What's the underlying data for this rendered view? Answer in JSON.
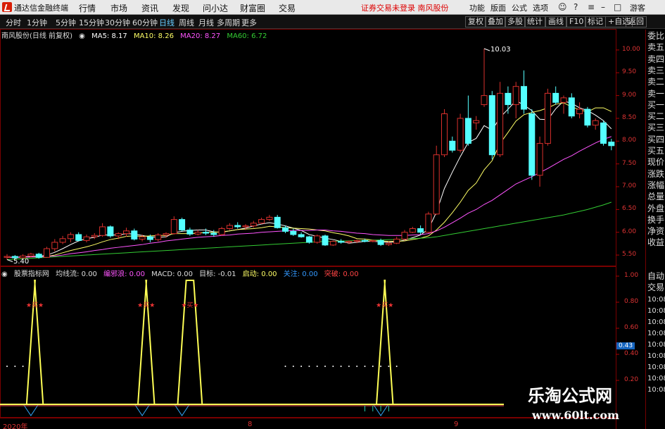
{
  "menubar": {
    "app_title": "通达信金融终端",
    "menus": [
      "行情",
      "市场",
      "资讯",
      "发现",
      "问小达",
      "财富圈",
      "交易"
    ],
    "alert": "证券交易未登录  南风股份",
    "right_items": [
      "功能",
      "版面",
      "公式",
      "选项"
    ],
    "guest": "游客"
  },
  "toolbar": {
    "periods": [
      "分时",
      "1分钟",
      "5分钟",
      "15分钟",
      "30分钟",
      "60分钟",
      "日线",
      "周线",
      "月线",
      "多周期",
      "更多"
    ],
    "active_period": "日线",
    "buttons": [
      "复权",
      "叠加",
      "多股",
      "统计",
      "画线",
      "F10",
      "标记",
      "+自选",
      "返回"
    ]
  },
  "price_info": {
    "stock": "南风股份(日线 前复权)",
    "ma5": "MA5: 8.17",
    "ma10": "MA10: 8.26",
    "ma20": "MA20: 8.27",
    "ma60": "MA60: 6.72"
  },
  "indicator_info": {
    "name": "股票指标网",
    "lamp": "均线流: 0.00",
    "monopoly": "编邪浪: 0.00",
    "macd": "MACD: 0.00",
    "target": "目标: -0.01",
    "start": "启动: 0.00",
    "focus": "关注: 0.00",
    "break": "突破: 0.00"
  },
  "annotations": {
    "high": "10.03",
    "low": "5.40",
    "buy_label": "★买★"
  },
  "price_axis": [
    "10.00",
    "9.50",
    "9.00",
    "8.50",
    "8.00",
    "7.50",
    "7.00",
    "6.50",
    "6.00",
    "5.50"
  ],
  "indicator_axis": [
    "1.00",
    "0.80",
    "0.60",
    "0.40",
    "0.20"
  ],
  "indicator_current": "0.43",
  "date_axis": [
    "2020年",
    "8",
    "9"
  ],
  "right_panel": {
    "items": [
      "委比",
      "卖五",
      "卖四",
      "卖三",
      "卖二",
      "卖一",
      "买一",
      "买二",
      "买三",
      "买四",
      "买五",
      "现价",
      "涨跌",
      "涨幅",
      "总量",
      "外盘",
      "换手",
      "净资",
      "收益"
    ],
    "lower": [
      "自动",
      "交易"
    ],
    "times": [
      "10:08",
      "10:08",
      "10:08",
      "10:08",
      "10:08",
      "10:08",
      "10:08",
      "10:08",
      "10:08"
    ]
  },
  "watermark": {
    "line1": "乐淘公式网",
    "line2": "www.60lt.com"
  },
  "colors": {
    "up": "#d9302c",
    "down": "#54ffff",
    "ma5": "#ffffff",
    "ma10": "#ffff66",
    "ma20": "#ff55ff",
    "ma60": "#33cc33",
    "indicator_line": "#ffff55"
  },
  "chart_data": {
    "type": "candlestick",
    "y_range": [
      5.3,
      10.2
    ],
    "candles": [
      {
        "o": 5.45,
        "h": 5.52,
        "l": 5.4,
        "c": 5.47
      },
      {
        "o": 5.47,
        "h": 5.5,
        "l": 5.42,
        "c": 5.44
      },
      {
        "o": 5.44,
        "h": 5.52,
        "l": 5.42,
        "c": 5.48
      },
      {
        "o": 5.48,
        "h": 5.55,
        "l": 5.45,
        "c": 5.52
      },
      {
        "o": 5.52,
        "h": 5.55,
        "l": 5.42,
        "c": 5.45
      },
      {
        "o": 5.45,
        "h": 5.68,
        "l": 5.44,
        "c": 5.64
      },
      {
        "o": 5.64,
        "h": 5.85,
        "l": 5.58,
        "c": 5.78
      },
      {
        "o": 5.78,
        "h": 5.92,
        "l": 5.74,
        "c": 5.86
      },
      {
        "o": 5.86,
        "h": 6.0,
        "l": 5.78,
        "c": 5.95
      },
      {
        "o": 5.95,
        "h": 6.0,
        "l": 5.8,
        "c": 5.82
      },
      {
        "o": 5.82,
        "h": 5.95,
        "l": 5.78,
        "c": 5.9
      },
      {
        "o": 5.9,
        "h": 5.98,
        "l": 5.85,
        "c": 5.93
      },
      {
        "o": 5.93,
        "h": 6.2,
        "l": 5.9,
        "c": 6.12
      },
      {
        "o": 6.12,
        "h": 6.15,
        "l": 5.88,
        "c": 5.92
      },
      {
        "o": 5.92,
        "h": 6.0,
        "l": 5.85,
        "c": 5.97
      },
      {
        "o": 5.97,
        "h": 6.1,
        "l": 5.9,
        "c": 6.03
      },
      {
        "o": 6.03,
        "h": 6.08,
        "l": 5.82,
        "c": 5.85
      },
      {
        "o": 5.85,
        "h": 5.95,
        "l": 5.8,
        "c": 5.9
      },
      {
        "o": 5.9,
        "h": 5.95,
        "l": 5.78,
        "c": 5.84
      },
      {
        "o": 5.84,
        "h": 5.98,
        "l": 5.8,
        "c": 5.94
      },
      {
        "o": 5.94,
        "h": 6.0,
        "l": 5.88,
        "c": 5.97
      },
      {
        "o": 5.97,
        "h": 6.35,
        "l": 5.95,
        "c": 6.28
      },
      {
        "o": 6.28,
        "h": 6.32,
        "l": 6.02,
        "c": 6.05
      },
      {
        "o": 6.05,
        "h": 6.1,
        "l": 5.92,
        "c": 5.96
      },
      {
        "o": 5.96,
        "h": 6.05,
        "l": 5.93,
        "c": 6.0
      },
      {
        "o": 6.0,
        "h": 6.08,
        "l": 5.94,
        "c": 5.98
      },
      {
        "o": 5.98,
        "h": 6.05,
        "l": 5.9,
        "c": 5.95
      },
      {
        "o": 5.95,
        "h": 6.12,
        "l": 5.92,
        "c": 6.08
      },
      {
        "o": 6.08,
        "h": 6.2,
        "l": 6.05,
        "c": 6.15
      },
      {
        "o": 6.15,
        "h": 6.22,
        "l": 6.08,
        "c": 6.12
      },
      {
        "o": 6.12,
        "h": 6.18,
        "l": 6.05,
        "c": 6.14
      },
      {
        "o": 6.14,
        "h": 6.25,
        "l": 6.1,
        "c": 6.2
      },
      {
        "o": 6.2,
        "h": 6.32,
        "l": 6.18,
        "c": 6.28
      },
      {
        "o": 6.28,
        "h": 6.38,
        "l": 6.25,
        "c": 6.33
      },
      {
        "o": 6.33,
        "h": 6.38,
        "l": 6.08,
        "c": 6.1
      },
      {
        "o": 6.1,
        "h": 6.15,
        "l": 5.98,
        "c": 6.02
      },
      {
        "o": 6.02,
        "h": 6.08,
        "l": 5.92,
        "c": 5.95
      },
      {
        "o": 5.95,
        "h": 6.0,
        "l": 5.88,
        "c": 5.9
      },
      {
        "o": 5.9,
        "h": 5.92,
        "l": 5.75,
        "c": 5.78
      },
      {
        "o": 5.78,
        "h": 5.95,
        "l": 5.75,
        "c": 5.92
      },
      {
        "o": 5.92,
        "h": 5.95,
        "l": 5.7,
        "c": 5.72
      },
      {
        "o": 5.72,
        "h": 5.82,
        "l": 5.7,
        "c": 5.8
      },
      {
        "o": 5.8,
        "h": 5.85,
        "l": 5.75,
        "c": 5.78
      },
      {
        "o": 5.78,
        "h": 5.82,
        "l": 5.74,
        "c": 5.8
      },
      {
        "o": 5.8,
        "h": 5.84,
        "l": 5.76,
        "c": 5.82
      },
      {
        "o": 5.82,
        "h": 5.86,
        "l": 5.78,
        "c": 5.8
      },
      {
        "o": 5.8,
        "h": 5.84,
        "l": 5.78,
        "c": 5.82
      },
      {
        "o": 5.82,
        "h": 5.86,
        "l": 5.7,
        "c": 5.73
      },
      {
        "o": 5.73,
        "h": 5.8,
        "l": 5.7,
        "c": 5.76
      },
      {
        "o": 5.76,
        "h": 5.9,
        "l": 5.74,
        "c": 5.85
      },
      {
        "o": 5.85,
        "h": 6.05,
        "l": 5.82,
        "c": 6.0
      },
      {
        "o": 6.0,
        "h": 6.12,
        "l": 5.98,
        "c": 6.08
      },
      {
        "o": 6.08,
        "h": 6.15,
        "l": 5.95,
        "c": 6.0
      },
      {
        "o": 6.0,
        "h": 6.45,
        "l": 5.98,
        "c": 6.4
      },
      {
        "o": 6.4,
        "h": 7.9,
        "l": 6.38,
        "c": 7.7
      },
      {
        "o": 7.7,
        "h": 8.7,
        "l": 7.65,
        "c": 8.6
      },
      {
        "o": 8.0,
        "h": 8.1,
        "l": 7.75,
        "c": 7.8
      },
      {
        "o": 7.8,
        "h": 8.6,
        "l": 7.75,
        "c": 8.5
      },
      {
        "o": 8.5,
        "h": 9.0,
        "l": 7.9,
        "c": 7.95
      },
      {
        "o": 8.4,
        "h": 8.55,
        "l": 8.25,
        "c": 8.45
      },
      {
        "o": 8.8,
        "h": 10.03,
        "l": 8.75,
        "c": 9.0
      },
      {
        "o": 9.0,
        "h": 9.1,
        "l": 7.6,
        "c": 7.7
      },
      {
        "o": 7.7,
        "h": 9.3,
        "l": 7.65,
        "c": 9.05
      },
      {
        "o": 9.05,
        "h": 9.2,
        "l": 8.6,
        "c": 8.8
      },
      {
        "o": 8.8,
        "h": 9.3,
        "l": 8.5,
        "c": 9.2
      },
      {
        "o": 9.2,
        "h": 9.55,
        "l": 8.6,
        "c": 8.7
      },
      {
        "o": 8.6,
        "h": 8.7,
        "l": 7.15,
        "c": 7.25
      },
      {
        "o": 7.25,
        "h": 8.1,
        "l": 7.0,
        "c": 7.95
      },
      {
        "o": 7.95,
        "h": 9.15,
        "l": 7.9,
        "c": 9.05
      },
      {
        "o": 9.05,
        "h": 9.2,
        "l": 8.8,
        "c": 8.85
      },
      {
        "o": 8.85,
        "h": 9.0,
        "l": 8.6,
        "c": 8.95
      },
      {
        "o": 8.95,
        "h": 9.05,
        "l": 8.5,
        "c": 8.55
      },
      {
        "o": 8.6,
        "h": 8.85,
        "l": 8.5,
        "c": 8.7
      },
      {
        "o": 8.7,
        "h": 8.75,
        "l": 8.3,
        "c": 8.35
      },
      {
        "o": 8.35,
        "h": 8.5,
        "l": 8.25,
        "c": 8.45
      },
      {
        "o": 8.4,
        "h": 8.45,
        "l": 7.9,
        "c": 7.95
      },
      {
        "o": 7.98,
        "h": 8.05,
        "l": 7.8,
        "c": 7.9
      }
    ],
    "ma_series": [
      {
        "name": "MA5",
        "values": [
          5.45,
          5.45,
          5.46,
          5.47,
          5.47,
          5.5,
          5.56,
          5.64,
          5.73,
          5.81,
          5.86,
          5.89,
          5.94,
          5.94,
          5.94,
          5.97,
          5.96,
          5.93,
          5.9,
          5.89,
          5.9,
          5.99,
          6.02,
          6.04,
          6.05,
          6.05,
          6.01,
          6.0,
          6.03,
          6.06,
          6.09,
          6.14,
          6.18,
          6.21,
          6.18,
          6.14,
          6.09,
          6.04,
          5.95,
          5.91,
          5.87,
          5.84,
          5.8,
          5.76,
          5.78,
          5.8,
          5.8,
          5.79,
          5.78,
          5.79,
          5.83,
          5.88,
          5.94,
          6.07,
          6.44,
          6.96,
          7.32,
          7.66,
          7.97,
          8.06,
          8.34,
          8.24,
          8.52,
          8.7,
          8.89,
          8.79,
          8.67,
          8.48,
          8.47,
          8.71,
          8.88,
          8.83,
          8.73,
          8.67,
          8.57,
          8.45,
          8.27
        ]
      },
      {
        "name": "MA10",
        "values": [
          5.45,
          5.45,
          5.45,
          5.46,
          5.46,
          5.47,
          5.5,
          5.55,
          5.6,
          5.64,
          5.68,
          5.73,
          5.79,
          5.84,
          5.87,
          5.91,
          5.92,
          5.91,
          5.92,
          5.93,
          5.93,
          5.97,
          5.97,
          5.97,
          5.98,
          6.0,
          6.0,
          6.01,
          6.03,
          6.06,
          6.07,
          6.08,
          6.1,
          6.13,
          6.12,
          6.1,
          6.09,
          6.08,
          6.07,
          6.05,
          6.03,
          5.99,
          5.96,
          5.92,
          5.86,
          5.85,
          5.83,
          5.81,
          5.8,
          5.8,
          5.81,
          5.84,
          5.87,
          5.92,
          6.05,
          6.22,
          6.43,
          6.66,
          6.92,
          7.08,
          7.37,
          7.57,
          7.95,
          8.19,
          8.44,
          8.58,
          8.63,
          8.67,
          8.73,
          8.81,
          8.84,
          8.75,
          8.69,
          8.64,
          8.73,
          8.73,
          8.65
        ]
      },
      {
        "name": "MA20",
        "values": [
          5.45,
          5.45,
          5.45,
          5.46,
          5.46,
          5.47,
          5.48,
          5.5,
          5.53,
          5.55,
          5.57,
          5.6,
          5.62,
          5.65,
          5.67,
          5.69,
          5.71,
          5.73,
          5.76,
          5.78,
          5.81,
          5.83,
          5.85,
          5.87,
          5.89,
          5.9,
          5.91,
          5.93,
          5.94,
          5.96,
          5.97,
          5.98,
          6.0,
          6.01,
          6.02,
          6.03,
          6.04,
          6.04,
          6.04,
          6.05,
          6.05,
          6.03,
          6.02,
          6.0,
          5.98,
          5.97,
          5.95,
          5.94,
          5.93,
          5.93,
          5.93,
          5.94,
          5.95,
          5.97,
          6.03,
          6.11,
          6.21,
          6.31,
          6.42,
          6.5,
          6.61,
          6.7,
          6.82,
          6.94,
          7.06,
          7.14,
          7.22,
          7.31,
          7.4,
          7.5,
          7.6,
          7.68,
          7.78,
          7.87,
          7.96,
          8.04,
          8.1
        ]
      },
      {
        "name": "MA60",
        "values": [
          5.4,
          5.41,
          5.42,
          5.43,
          5.44,
          5.45,
          5.46,
          5.47,
          5.48,
          5.49,
          5.5,
          5.51,
          5.52,
          5.53,
          5.54,
          5.55,
          5.56,
          5.57,
          5.58,
          5.59,
          5.6,
          5.61,
          5.62,
          5.63,
          5.64,
          5.65,
          5.66,
          5.67,
          5.68,
          5.69,
          5.7,
          5.71,
          5.72,
          5.73,
          5.74,
          5.75,
          5.76,
          5.77,
          5.78,
          5.79,
          5.8,
          5.8,
          5.81,
          5.81,
          5.82,
          5.82,
          5.83,
          5.83,
          5.84,
          5.84,
          5.85,
          5.86,
          5.87,
          5.88,
          5.9,
          5.93,
          5.96,
          5.99,
          6.02,
          6.05,
          6.08,
          6.11,
          6.14,
          6.17,
          6.2,
          6.23,
          6.26,
          6.29,
          6.32,
          6.35,
          6.38,
          6.42,
          6.46,
          6.5,
          6.55,
          6.6,
          6.66
        ]
      }
    ],
    "indicator": {
      "signal_indices": [
        [
          3,
          4
        ],
        [
          17,
          18
        ],
        [
          22,
          24
        ],
        [
          47,
          48
        ]
      ],
      "dots_indices": [
        0,
        1,
        2,
        35,
        36,
        37,
        38,
        39,
        40,
        41,
        42,
        43,
        44,
        45,
        46,
        47,
        48,
        49
      ]
    }
  }
}
